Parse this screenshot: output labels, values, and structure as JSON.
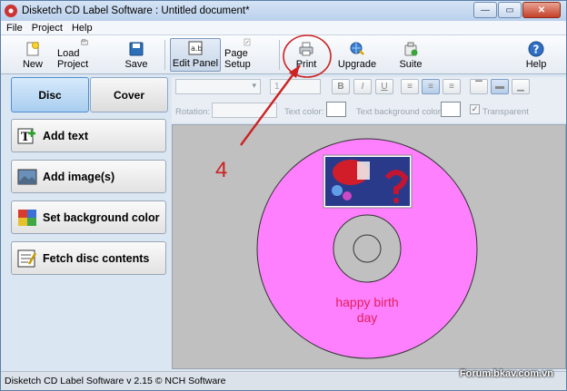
{
  "window": {
    "title": "Disketch CD Label Software : Untitled document*",
    "controls": {
      "minimize": "—",
      "maximize": "▭",
      "close": "✕"
    }
  },
  "menu": [
    "File",
    "Project",
    "Help"
  ],
  "toolbar": {
    "new": "New",
    "load_project": "Load Project",
    "save": "Save",
    "edit_panel": "Edit Panel",
    "page_setup": "Page Setup",
    "print": "Print",
    "upgrade": "Upgrade",
    "suite": "Suite",
    "help": "Help"
  },
  "tabs": {
    "disc": "Disc",
    "cover": "Cover",
    "active": "Disc"
  },
  "actions": {
    "add_text": "Add text",
    "add_images": "Add image(s)",
    "set_background": "Set background color",
    "fetch_contents": "Fetch disc contents"
  },
  "properties": {
    "font_size_value": "1",
    "bold": "B",
    "italic": "I",
    "underline": "U",
    "rotation_label": "Rotation:",
    "text_color_label": "Text color:",
    "text_bg_color_label": "Text background color:",
    "transparent_label": "Transparent",
    "transparent_checked": true
  },
  "disc": {
    "label_text_line1": "happy birth",
    "label_text_line2": "day",
    "disc_color": "#ff80ff",
    "text_color": "#e0205a"
  },
  "annotation": {
    "step_number": "4",
    "color": "#cc2222"
  },
  "status": {
    "text": "Disketch CD Label Software v 2.15 © NCH Software",
    "watermark": "Forum.bkav.com.vn"
  }
}
